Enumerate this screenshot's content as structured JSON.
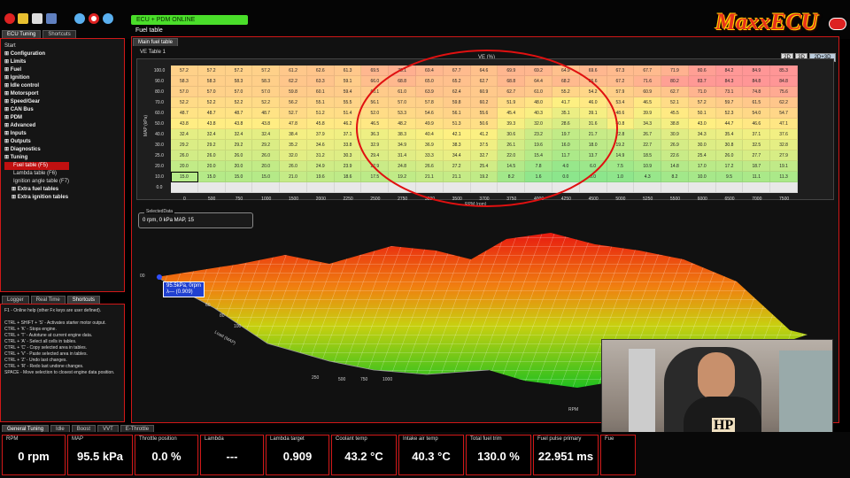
{
  "app": {
    "logo": "MaxxECU",
    "status": "ECU + PDM ONLINE",
    "window_title": "Fuel table"
  },
  "left_tabs": [
    "ECU Tuning",
    "Shortcuts"
  ],
  "tree": [
    {
      "label": "Start",
      "cls": ""
    },
    {
      "label": "Configuration",
      "cls": "b"
    },
    {
      "label": "Limits",
      "cls": "b"
    },
    {
      "label": "Fuel",
      "cls": "b"
    },
    {
      "label": "Ignition",
      "cls": "b"
    },
    {
      "label": "Idle control",
      "cls": "b"
    },
    {
      "label": "Motorsport",
      "cls": "b"
    },
    {
      "label": "Speed/Gear",
      "cls": "b"
    },
    {
      "label": "CAN Bus",
      "cls": "b"
    },
    {
      "label": "PDM",
      "cls": "b"
    },
    {
      "label": "Advanced",
      "cls": "b"
    },
    {
      "label": "Inputs",
      "cls": "b"
    },
    {
      "label": "Outputs",
      "cls": "b"
    },
    {
      "label": "Diagnostics",
      "cls": "b"
    },
    {
      "label": "Tuning",
      "cls": "b"
    },
    {
      "label": "Fuel table (F5)",
      "cls": "sel"
    },
    {
      "label": "Lambda table (F6)",
      "cls": ""
    },
    {
      "label": "Ignition angle table (F7)",
      "cls": ""
    },
    {
      "label": "Extra fuel tables",
      "cls": "b"
    },
    {
      "label": "Extra ignition tables",
      "cls": "b"
    }
  ],
  "help_tabs": [
    "Logger",
    "Real Time",
    "Shortcuts"
  ],
  "help": [
    "F1 - Online help (other Fx keys are user defined).",
    "",
    "CTRL + SHIFT + 'S' - Activates starter motor output.",
    "CTRL + 'K' - Stops engine.",
    "CTRL + 'T' - Autotune at current engine data.",
    "CTRL + 'A' - Select all cells in tables.",
    "CTRL + 'C' - Copy selected area in tables.",
    "CTRL + 'V' - Paste selected area in tables.",
    "CTRL + 'Z' - Undo last changes.",
    "CTRL + 'R' - Redo last undone changes.",
    "SPACE - Move selection to closest engine data position."
  ],
  "main_tab": "Main fuel table",
  "ve": {
    "title": "VE Table 1",
    "ylabel": "MAP (kPa)",
    "xlabel": "RPM (rpm)",
    "zlabel": "VE (%)",
    "views": [
      "2D",
      "3D",
      "2D+3D"
    ],
    "rpm": [
      "0",
      "500",
      "750",
      "1000",
      "1500",
      "2000",
      "2250",
      "2500",
      "2750",
      "3000",
      "3500",
      "3700",
      "3750",
      "4000",
      "4250",
      "4500",
      "5000",
      "5250",
      "5500",
      "6000",
      "6500",
      "7000",
      "7500"
    ],
    "map": [
      "100.0",
      "90.0",
      "80.0",
      "70.0",
      "60.0",
      "50.0",
      "40.0",
      "30.0",
      "25.0",
      "20.0",
      "10.0",
      "0.0"
    ],
    "rows": [
      [
        "57.2",
        "57.2",
        "57.2",
        "57.2",
        "61.2",
        "62.6",
        "61.3",
        "69.5",
        "73.1",
        "69.4",
        "67.7",
        "64.6",
        "69.9",
        "69.2",
        "64.9",
        "69.6",
        "67.3",
        "67.7",
        "71.9",
        "80.6",
        "84.2",
        "84.9",
        "85.3"
      ],
      [
        "58.3",
        "58.3",
        "58.3",
        "58.3",
        "62.2",
        "63.3",
        "59.1",
        "66.0",
        "68.8",
        "65.0",
        "65.2",
        "62.7",
        "68.8",
        "64.4",
        "68.2",
        "66.6",
        "67.2",
        "71.6",
        "80.2",
        "83.7",
        "84.3",
        "84.8",
        "84.8"
      ],
      [
        "57.0",
        "57.0",
        "57.0",
        "57.0",
        "59.8",
        "60.1",
        "59.4",
        "60.1",
        "61.0",
        "63.9",
        "62.4",
        "60.9",
        "62.7",
        "61.0",
        "55.2",
        "54.2",
        "57.9",
        "60.9",
        "62.7",
        "71.0",
        "73.1",
        "74.8",
        "75.6"
      ],
      [
        "52.2",
        "52.2",
        "52.2",
        "52.2",
        "56.2",
        "55.1",
        "55.5",
        "56.1",
        "57.0",
        "57.8",
        "59.8",
        "60.2",
        "51.9",
        "48.0",
        "41.7",
        "46.0",
        "53.4",
        "46.5",
        "52.1",
        "57.2",
        "59.7",
        "61.5",
        "62.2"
      ],
      [
        "48.7",
        "48.7",
        "48.7",
        "48.7",
        "52.7",
        "51.2",
        "51.4",
        "52.0",
        "53.3",
        "54.6",
        "56.1",
        "55.6",
        "45.4",
        "40.3",
        "35.1",
        "39.1",
        "48.6",
        "39.9",
        "45.5",
        "50.1",
        "52.3",
        "54.0",
        "54.7"
      ],
      [
        "43.8",
        "43.8",
        "43.8",
        "43.8",
        "47.8",
        "45.8",
        "46.2",
        "46.5",
        "48.2",
        "49.9",
        "51.3",
        "50.6",
        "39.3",
        "32.0",
        "28.6",
        "31.6",
        "40.8",
        "34.3",
        "38.8",
        "43.0",
        "44.7",
        "46.6",
        "47.1"
      ],
      [
        "32.4",
        "32.4",
        "32.4",
        "32.4",
        "38.4",
        "37.9",
        "37.1",
        "36.3",
        "38.3",
        "40.4",
        "42.1",
        "41.2",
        "30.6",
        "23.2",
        "19.7",
        "21.7",
        "22.8",
        "26.7",
        "30.9",
        "34.3",
        "35.4",
        "37.1",
        "37.6"
      ],
      [
        "29.2",
        "29.2",
        "29.2",
        "29.2",
        "35.2",
        "34.6",
        "33.8",
        "32.9",
        "34.9",
        "36.9",
        "38.3",
        "37.5",
        "26.1",
        "19.6",
        "16.0",
        "18.0",
        "19.2",
        "22.7",
        "26.9",
        "30.0",
        "30.8",
        "32.5",
        "32.8"
      ],
      [
        "26.0",
        "26.0",
        "26.0",
        "26.0",
        "32.0",
        "31.2",
        "30.3",
        "29.4",
        "31.4",
        "33.3",
        "34.4",
        "32.7",
        "22.0",
        "15.4",
        "11.7",
        "13.7",
        "14.9",
        "18.5",
        "22.6",
        "25.4",
        "26.0",
        "27.7",
        "27.9"
      ],
      [
        "20.0",
        "20.0",
        "20.0",
        "20.0",
        "26.0",
        "24.9",
        "23.9",
        "22.9",
        "24.8",
        "26.6",
        "27.2",
        "25.4",
        "14.5",
        "7.8",
        "4.0",
        "6.0",
        "7.5",
        "10.9",
        "14.8",
        "17.0",
        "17.2",
        "18.7",
        "19.1"
      ],
      [
        "15.0",
        "15.0",
        "15.0",
        "15.0",
        "21.0",
        "19.6",
        "18.6",
        "17.5",
        "19.2",
        "21.1",
        "21.1",
        "19.2",
        "8.2",
        "1.6",
        "0.0",
        "0.0",
        "1.0",
        "4.3",
        "8.2",
        "10.0",
        "9.5",
        "11.1",
        "11.3"
      ],
      [
        "",
        "",
        "",
        "",
        "",
        "",
        "",
        "",
        "",
        "",
        "",
        "",
        "",
        "",
        "",
        "",
        "",
        "",
        "",
        "",
        "",
        "",
        ""
      ]
    ]
  },
  "selected_data": {
    "title": "SelectedData",
    "value": "0 rpm, 0 kPa MAP, 15"
  },
  "surface": {
    "tooltip1": "95.5kPa, 0rpm",
    "tooltip2": "λ— (0.909)",
    "y_axis": "Load (MAP)",
    "x_axis": "RPM",
    "ticks": [
      "00",
      "60",
      "80",
      "100",
      "250",
      "500",
      "750",
      "1000"
    ]
  },
  "bottom_tabs": [
    "General Tuning",
    "Idle",
    "Boost",
    "VVT",
    "E-Throttle"
  ],
  "gauges": [
    {
      "label": "RPM",
      "value": "0 rpm"
    },
    {
      "label": "MAP",
      "value": "95.5 kPa"
    },
    {
      "label": "Throttle position",
      "value": "0.0 %"
    },
    {
      "label": "Lambda",
      "value": "---"
    },
    {
      "label": "Lambda target",
      "value": "0.909"
    },
    {
      "label": "Coolant temp",
      "value": "43.2 °C"
    },
    {
      "label": "Intake air temp",
      "value": "40.3 °C"
    },
    {
      "label": "Total fuel trim",
      "value": "130.0 %"
    },
    {
      "label": "Fuel pulse primary",
      "value": "22.951 ms"
    },
    {
      "label": "Fue",
      "value": ""
    }
  ],
  "colors": {
    "accent": "#d01818",
    "online": "#4ade2a",
    "selection": "#c01010"
  },
  "webcam": {
    "shirt_text": "HP"
  }
}
